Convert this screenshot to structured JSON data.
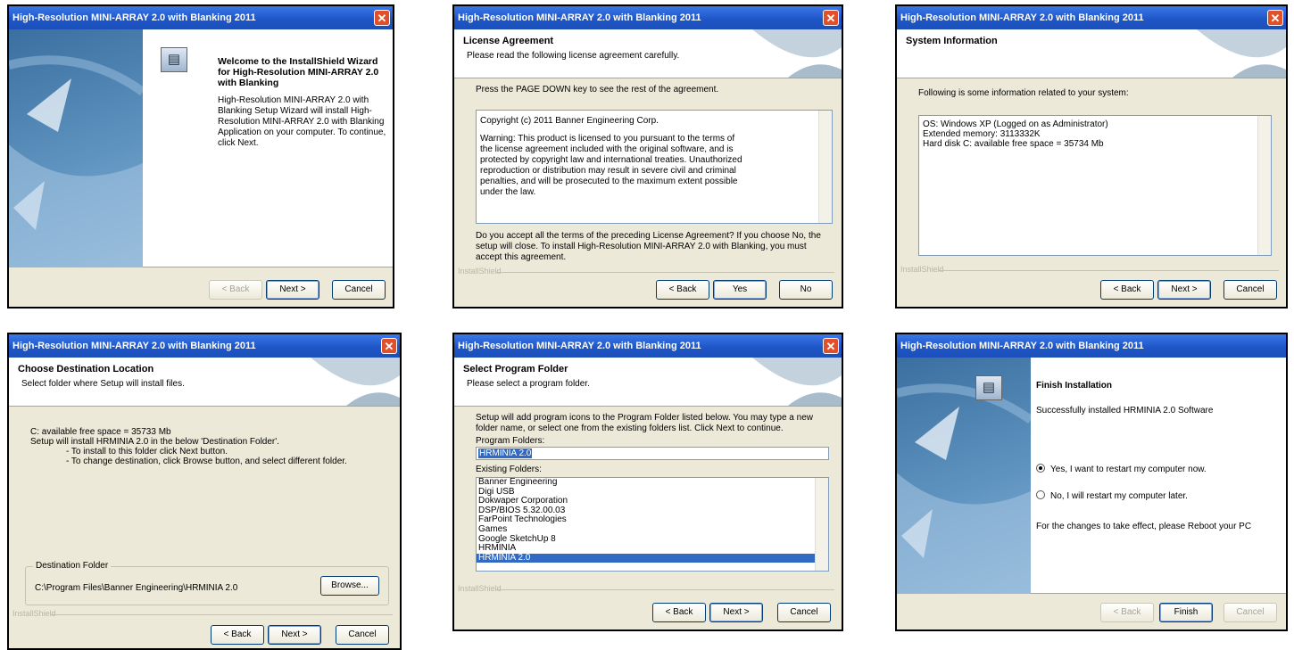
{
  "window_title": "High-Resolution MINI-ARRAY 2.0 with Blanking 2011",
  "buttons": {
    "back": "< Back",
    "next": "Next >",
    "cancel": "Cancel",
    "yes": "Yes",
    "no": "No",
    "browse": "Browse...",
    "finish": "Finish"
  },
  "installshield_label": "InstallShield",
  "welcome": {
    "heading": "Welcome to the InstallShield Wizard for High-Resolution MINI-ARRAY 2.0 with Blanking",
    "body": "High-Resolution MINI-ARRAY 2.0 with Blanking Setup Wizard will install High-Resolution MINI-ARRAY 2.0 with Blanking Application on your computer. To continue, click Next."
  },
  "license": {
    "title": "License Agreement",
    "subtitle": "Please read the following license agreement carefully.",
    "instruction": "Press the PAGE DOWN key to see the rest of the agreement.",
    "text_copyright": "Copyright (c) 2011 Banner Engineering Corp.",
    "text_warning": "Warning: This product is licensed to you pursuant to the terms of the license agreement included with the original software, and is protected by copyright law and international treaties. Unauthorized reproduction or distribution may result in severe civil and criminal penalties, and will be prosecuted to the maximum extent possible under the law.",
    "question": "Do you accept all the terms of the preceding License Agreement? If you choose No, the setup will close. To install High-Resolution MINI-ARRAY 2.0 with Blanking, you must accept this agreement."
  },
  "sysinfo": {
    "title": "System Information",
    "intro": "Following is some information related to your system:",
    "line_os": "OS: Windows XP (Logged on as Administrator)",
    "line_mem": "Extended memory: 3113332K",
    "line_disk": "Hard disk C: available free space = 35734 Mb"
  },
  "destination": {
    "title": "Choose Destination Location",
    "subtitle": "Select folder where Setup will install files.",
    "free_space": "C: available free space = 35733 Mb",
    "line2": "Setup will install HRMINIA 2.0 in the below 'Destination Folder'.",
    "line3": "- To install to this folder click Next button.",
    "line4": "- To change destination, click Browse button, and select different folder.",
    "group_label": "Destination Folder",
    "path": "C:\\Program Files\\Banner Engineering\\HRMINIA 2.0"
  },
  "program_folder": {
    "title": "Select Program Folder",
    "subtitle": "Please select a program folder.",
    "intro": "Setup will add program icons to the Program Folder listed below. You may type a new folder name, or select one from the existing folders list. Click Next to continue.",
    "folder_label": "Program Folders:",
    "folder_value": "HRMINIA 2.0",
    "existing_label": "Existing Folders:",
    "existing": [
      "Banner Engineering",
      "Digi USB",
      "Dokwaper Corporation",
      "DSP/BIOS 5.32.00.03",
      "FarPoint Technologies",
      "Games",
      "Google SketchUp 8",
      "HRMINIA",
      "HRMINIA 2.0"
    ],
    "selected_index": 8
  },
  "finish": {
    "title": "Finish Installation",
    "message": "Successfully installed HRMINIA 2.0 Software",
    "option_yes": "Yes, I want to restart my computer now.",
    "option_no": "No, I will restart my computer later.",
    "note": "For the changes to take effect, please Reboot your PC",
    "selected_option": "yes"
  }
}
